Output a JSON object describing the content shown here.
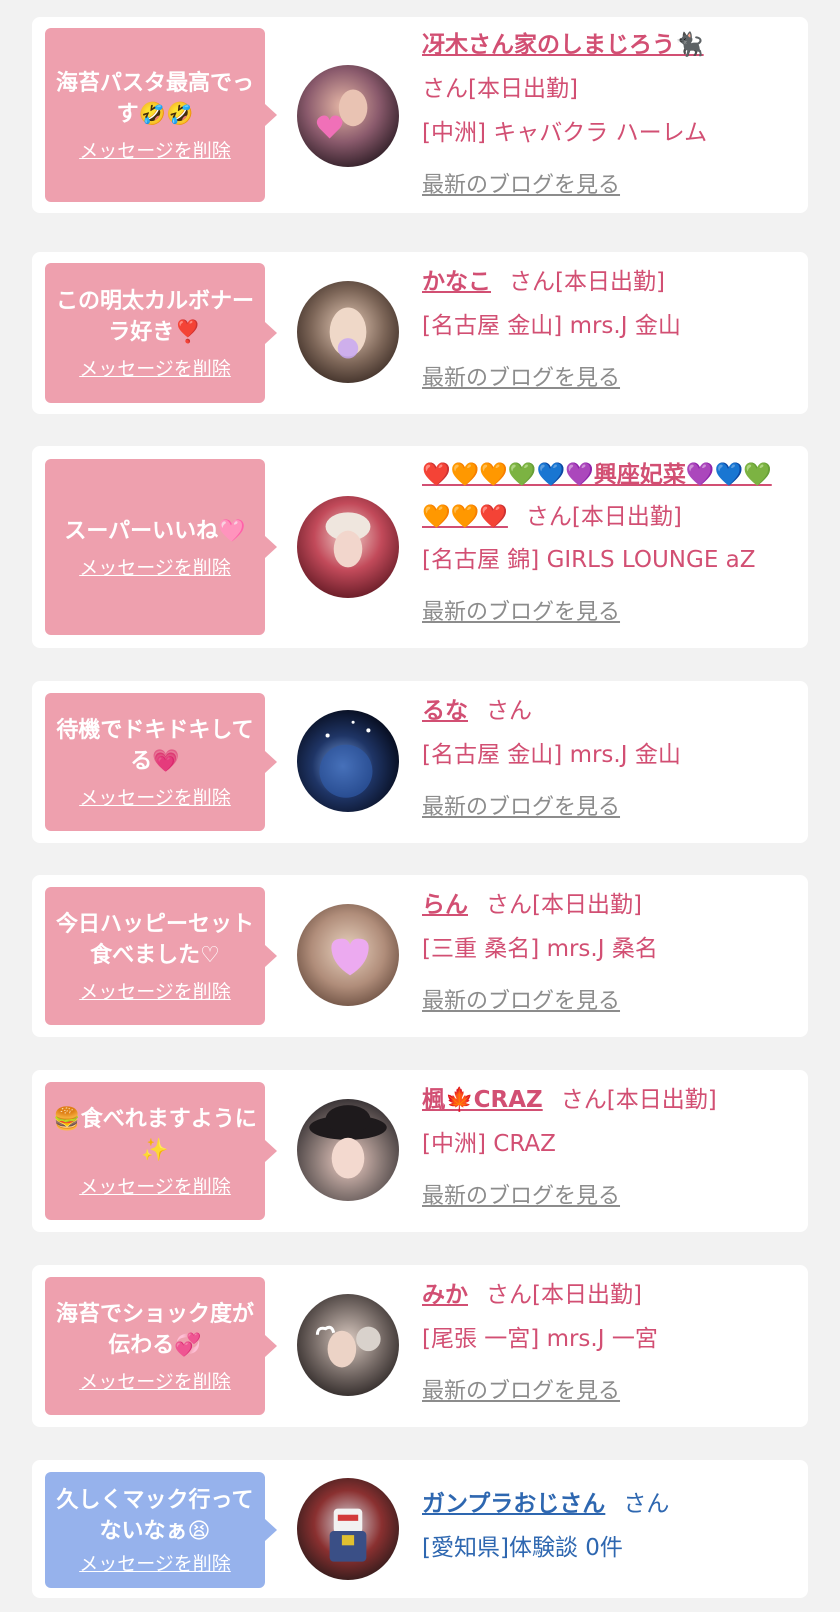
{
  "common": {
    "delete_label": "メッセージを削除",
    "blog_label": "最新のブログを見る"
  },
  "items": [
    {
      "message": "海苔パスタ最高でっす🤣🤣",
      "name": "冴木さん家のしまじろう🐈‍⬛",
      "san": "さん[本日出勤]",
      "shop": "[中洲] キャバクラ ハーレム",
      "bubble_color": "#eea0ae",
      "avatar_color": "#8a5a6c"
    },
    {
      "message": "この明太カルボナーラ好き❣️",
      "name": "かなこ",
      "san": "さん[本日出勤]",
      "shop": "[名古屋 金山] mrs.J 金山",
      "bubble_color": "#eea0ae",
      "avatar_color": "#7d6658"
    },
    {
      "message": "スーパーいいね🩷",
      "name": "❤️🧡🧡💚💙💜興座妃菜💜💙💚🧡🧡❤️",
      "san": "さん[本日出勤]",
      "shop": "[名古屋 錦] GIRLS LOUNGE aZ",
      "bubble_color": "#eea0ae",
      "avatar_color": "#c24a5a"
    },
    {
      "message": "待機でドキドキしてる💗",
      "name": "るな",
      "san": "さん",
      "shop": "[名古屋 金山] mrs.J 金山",
      "bubble_color": "#eea0ae",
      "avatar_color": "#1f3566"
    },
    {
      "message": "今日ハッピーセット食べました♡",
      "name": "らん",
      "san": "さん[本日出勤]",
      "shop": "[三重 桑名] mrs.J 桑名",
      "bubble_color": "#eea0ae",
      "avatar_color": "#b08d7a"
    },
    {
      "message": "🍔食べれますように✨",
      "name": "楓🍁CRAZ",
      "san": "さん[本日出勤]",
      "shop": "[中洲] CRAZ",
      "bubble_color": "#eea0ae",
      "avatar_color": "#3b3537"
    },
    {
      "message": "海苔でショック度が伝わる💞",
      "name": "みか",
      "san": "さん[本日出勤]",
      "shop": "[尾張 一宮] mrs.J 一宮",
      "bubble_color": "#eea0ae",
      "avatar_color": "#6f6460"
    },
    {
      "message": "久しくマック行ってないなぁ😫",
      "name": "ガンプラおじさん",
      "san": "さん",
      "shop": "[愛知県]体験談 0件",
      "bubble_color": "#96b2ec",
      "avatar_color": "#3a4f86"
    }
  ]
}
